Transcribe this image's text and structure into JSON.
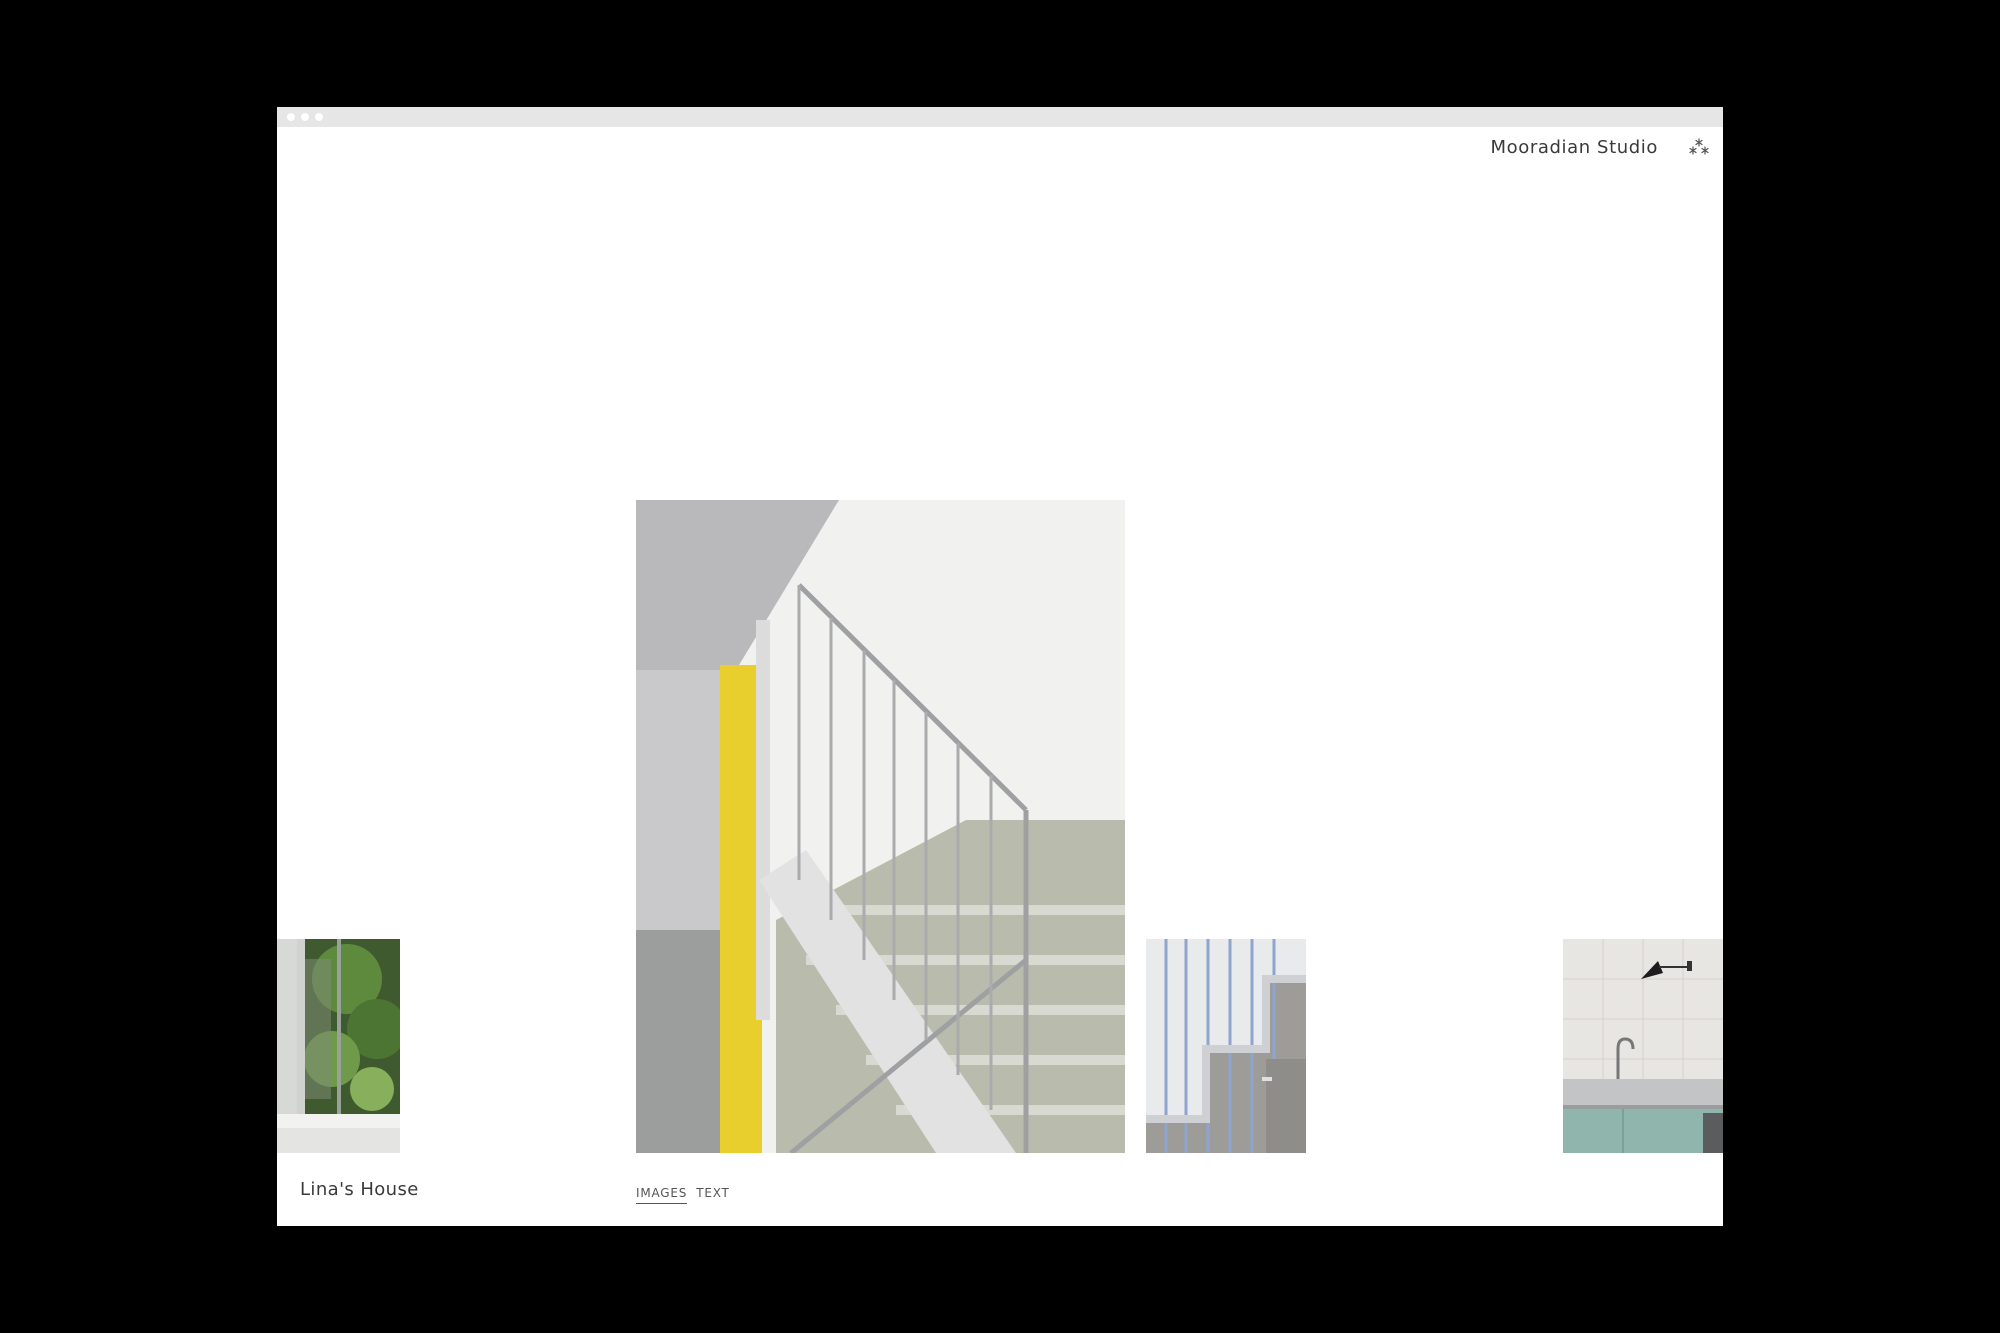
{
  "header": {
    "studio_name": "Mooradian Studio",
    "menu_icon": "asterisk-cluster-icon"
  },
  "project": {
    "title": "Lina's House"
  },
  "view_tabs": [
    {
      "label": "IMAGES",
      "active": true
    },
    {
      "label": "TEXT",
      "active": false
    }
  ],
  "gallery": [
    {
      "name": "window-thumbnail",
      "subject": "open window with trees"
    },
    {
      "name": "staircase-main-image",
      "subject": "staircase with yellow column and metal railing"
    },
    {
      "name": "stair-detail-thumbnail",
      "subject": "stair railing detail"
    },
    {
      "name": "kitchen-thumbnail",
      "subject": "kitchen with sink and wall lamp"
    }
  ],
  "colors": {
    "background": "#000000",
    "page": "#ffffff",
    "text": "#3a3a3a",
    "accent_yellow": "#e8cf2e",
    "cabinet_teal": "#8fb5ad"
  }
}
